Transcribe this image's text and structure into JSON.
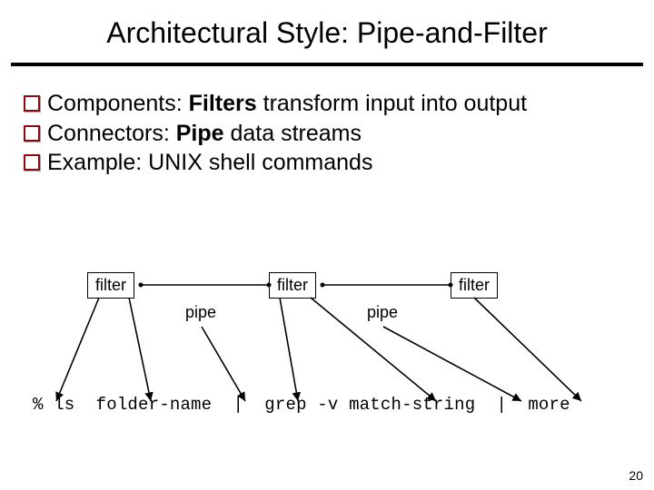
{
  "title": "Architectural Style: Pipe-and-Filter",
  "bullets": [
    {
      "prefix": "Components: ",
      "bold": "Filters",
      "rest": " transform input into output"
    },
    {
      "prefix": "Connectors: ",
      "bold": "Pipe",
      "rest": " data streams"
    },
    {
      "prefix": "Example: UNIX shell commands",
      "bold": "",
      "rest": ""
    }
  ],
  "diagram": {
    "box1": "filter",
    "box2": "filter",
    "box3": "filter",
    "pipe1": "pipe",
    "pipe2": "pipe"
  },
  "cmd": {
    "c1": "% ls  ",
    "c2": "folder-name",
    "c3": "  |  ",
    "c4": "grep -v match-string",
    "c5": "  |  ",
    "c6": "more"
  },
  "pagenum": "20"
}
